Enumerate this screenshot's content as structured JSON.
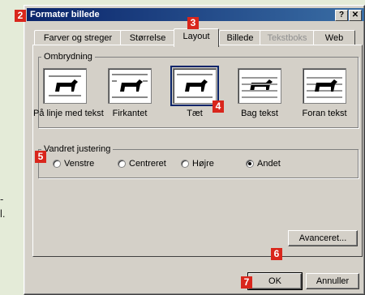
{
  "page": {
    "side_text_1": "-",
    "side_text_2": "l."
  },
  "dialog": {
    "title": "Formater billede",
    "help_btn": "?",
    "close_btn": "✕",
    "tabs": [
      {
        "label": "Farver og streger"
      },
      {
        "label": "Størrelse"
      },
      {
        "label": "Layout"
      },
      {
        "label": "Billede"
      },
      {
        "label": "Tekstboks"
      },
      {
        "label": "Web"
      }
    ],
    "wrap_group": "Ombrydning",
    "wrap_options": [
      {
        "label": "På linje med tekst"
      },
      {
        "label": "Firkantet"
      },
      {
        "label": "Tæt"
      },
      {
        "label": "Bag tekst"
      },
      {
        "label": "Foran tekst"
      }
    ],
    "align_group": "Vandret justering",
    "align_options": [
      {
        "label": "Venstre"
      },
      {
        "label": "Centreret"
      },
      {
        "label": "Højre"
      },
      {
        "label": "Andet"
      }
    ],
    "advanced_btn": "Avanceret...",
    "ok_btn": "OK",
    "cancel_btn": "Annuller"
  },
  "callouts": [
    "2",
    "3",
    "4",
    "5",
    "6",
    "7"
  ],
  "colors": {
    "badge": "#d9261c",
    "titlebar": "#0a246a",
    "background": "#e4ebd8"
  },
  "icons": {
    "wrap": "dog-icon"
  }
}
